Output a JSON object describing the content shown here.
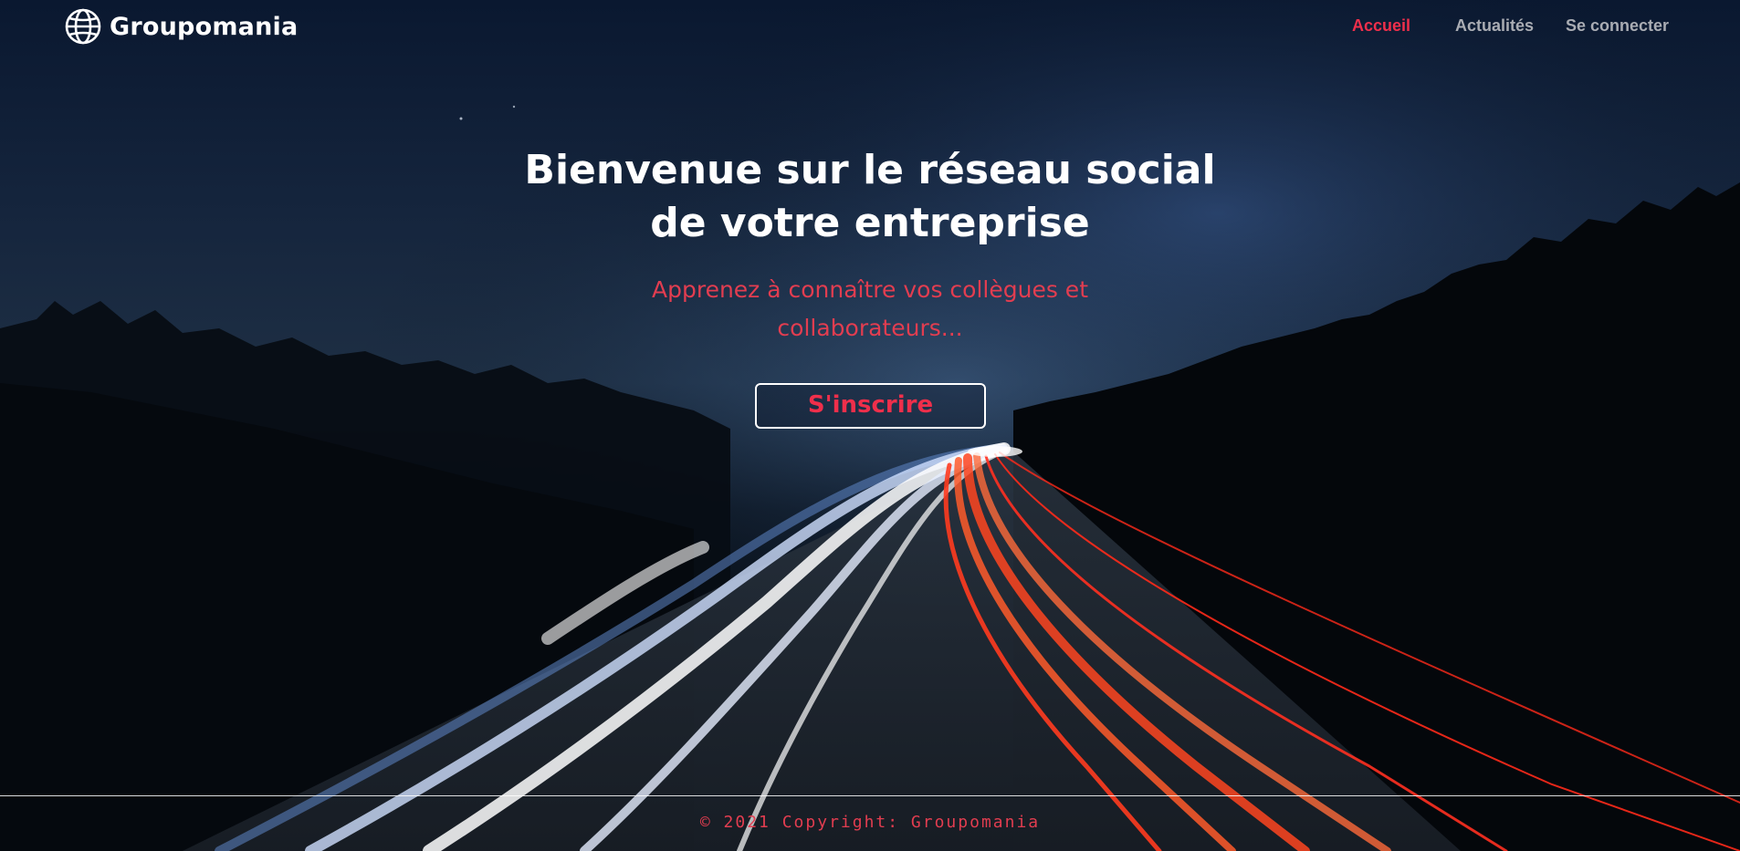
{
  "header": {
    "brand_name": "Groupomania",
    "brand_icon": "globe-icon",
    "nav": [
      {
        "label": "Accueil",
        "active": true
      },
      {
        "label": "Actualités",
        "active": false
      },
      {
        "label": "Se connecter",
        "active": false
      }
    ]
  },
  "hero": {
    "title_line1": "Bienvenue sur le réseau social",
    "title_line2": "de votre entreprise",
    "subtitle_line1": "Apprenez à connaître vos collègues et",
    "subtitle_line2": "collaborateurs...",
    "cta_label": "S'inscrire"
  },
  "footer": {
    "copyright": "© 2021 Copyright: Groupomania"
  },
  "colors": {
    "accent": "#ef2f4b",
    "nav_inactive": "#a9acb3",
    "title": "#ffffff",
    "background": "#050b14"
  }
}
